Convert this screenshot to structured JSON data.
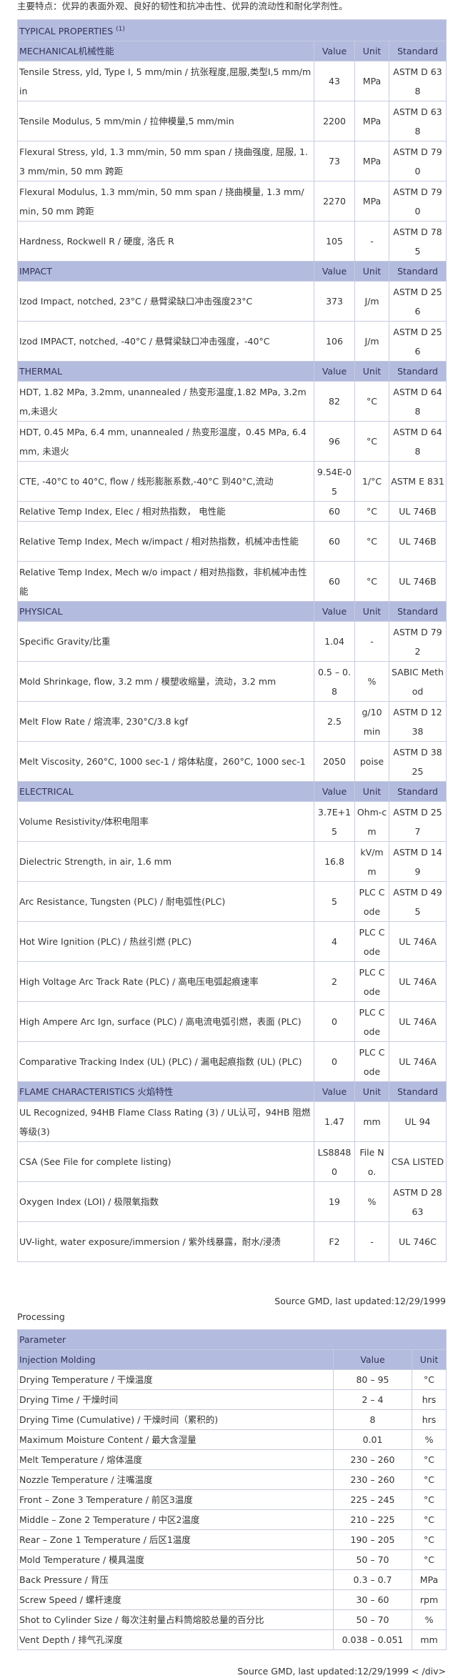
{
  "intro": "主要特点：优异的表面外观、良好的韧性和抗冲击性、优异的流动性和耐化学剂性。",
  "title": "TYPICAL PROPERTIES",
  "title_sup": "(1)",
  "headers": {
    "value": "Value",
    "unit": "Unit",
    "standard": "Standard"
  },
  "sections": [
    {
      "name": "MECHANICAL机械性能",
      "rows": [
        {
          "property": "Tensile Stress, yld, Type I, 5 mm/min / 抗张程度,屈服,类型I,5 mm/min",
          "value": "43",
          "unit": "MPa",
          "standard": "ASTM D 638"
        },
        {
          "property": "Tensile Modulus, 5 mm/min / 拉伸模量,5 mm/min",
          "value": "2200",
          "unit": "MPa",
          "standard": "ASTM D 638"
        },
        {
          "property": "Flexural Stress, yld, 1.3 mm/min, 50 mm span / 挠曲强度, 屈服, 1.3 mm/min, 50 mm 跨距",
          "value": "73",
          "unit": "MPa",
          "standard": "ASTM D 790"
        },
        {
          "property": "Flexural Modulus, 1.3 mm/min, 50 mm span / 挠曲模量, 1.3 mm/min, 50 mm 跨距",
          "value": "2270",
          "unit": "MPa",
          "standard": "ASTM D 790"
        },
        {
          "property": "Hardness, Rockwell R / 硬度, 洛氏 R",
          "value": "105",
          "unit": "-",
          "standard": "ASTM D 785"
        }
      ]
    },
    {
      "name": "IMPACT",
      "rows": [
        {
          "property": "Izod Impact, notched, 23°C / 悬臂梁缺口冲击强度23°C",
          "value": "373",
          "unit": "J/m",
          "standard": "ASTM D 256"
        },
        {
          "property": "Izod IMPACT, notched, -40°C / 悬臂梁缺口冲击强度，-40°C",
          "value": "106",
          "unit": "J/m",
          "standard": "ASTM D 256"
        }
      ]
    },
    {
      "name": "THERMAL",
      "rows": [
        {
          "property": "HDT, 1.82 MPa, 3.2mm, unannealed / 热变形温度,1.82 MPa, 3.2mm,未退火",
          "value": "82",
          "unit": "°C",
          "standard": "ASTM D 648"
        },
        {
          "property": "HDT, 0.45 MPa, 6.4 mm, unannealed / 热变形温度，0.45 MPa, 6.4 mm, 未退火",
          "value": "96",
          "unit": "°C",
          "standard": "ASTM D 648"
        },
        {
          "property": "CTE, -40°C to 40°C, flow / 线形膨胀系数,-40°C 到40°C,流动",
          "value": "9.54E-05",
          "unit": "1/°C",
          "standard": "ASTM E 831"
        },
        {
          "property": "Relative Temp Index, Elec / 相对热指数， 电性能",
          "value": "60",
          "unit": "°C",
          "standard": "UL 746B",
          "short": true
        },
        {
          "property": "Relative Temp Index, Mech w/impact / 相对热指数，机械冲击性能",
          "value": "60",
          "unit": "°C",
          "standard": "UL 746B"
        },
        {
          "property": "Relative Temp Index, Mech w/o impact / 相对热指数，非机械冲击性能",
          "value": "60",
          "unit": "°C",
          "standard": "UL 746B"
        }
      ]
    },
    {
      "name": "PHYSICAL",
      "rows": [
        {
          "property": "Specific Gravity/比重",
          "value": "1.04",
          "unit": "-",
          "standard": "ASTM D 792"
        },
        {
          "property": "Mold Shrinkage, flow, 3.2 mm / 模塑收缩量，流动，3.2 mm",
          "value": "0.5 – 0.8",
          "unit": "%",
          "standard": "SABIC Method"
        },
        {
          "property": "Melt Flow Rate / 熔流率, 230°C/3.8 kgf",
          "value": "2.5",
          "unit": "g/10 min",
          "standard": "ASTM D 1238"
        },
        {
          "property": "Melt Viscosity, 260°C, 1000 sec-1 / 熔体粘度，260°C, 1000 sec-1",
          "value": "2050",
          "unit": "poise",
          "standard": "ASTM D 3825"
        }
      ]
    },
    {
      "name": "ELECTRICAL",
      "rows": [
        {
          "property": "Volume Resistivity/体积电阻率",
          "value": "3.7E+15",
          "unit": "Ohm-cm",
          "standard": "ASTM D 257"
        },
        {
          "property": "Dielectric Strength, in air, 1.6 mm",
          "value": "16.8",
          "unit": "kV/mm",
          "standard": "ASTM D 149"
        },
        {
          "property": "Arc Resistance, Tungsten (PLC) / 耐电弧性(PLC)",
          "value": "5",
          "unit": "PLC Code",
          "standard": "ASTM D 495"
        },
        {
          "property": "Hot Wire Ignition (PLC) / 热丝引燃 (PLC)",
          "value": "4",
          "unit": "PLC Code",
          "standard": "UL 746A"
        },
        {
          "property": "High Voltage Arc Track Rate (PLC) / 高电压电弧起痕速率",
          "value": "2",
          "unit": "PLC Code",
          "standard": "UL 746A"
        },
        {
          "property": "High Ampere Arc Ign, surface (PLC) / 高电流电弧引燃，表面 (PLC)",
          "value": "0",
          "unit": "PLC Code",
          "standard": "UL 746A"
        },
        {
          "property": "Comparative Tracking Index (UL) (PLC) / 漏电起痕指数 (UL) (PLC)",
          "value": "0",
          "unit": "PLC Code",
          "standard": "UL 746A"
        }
      ]
    },
    {
      "name": "FLAME CHARACTERISTICS 火焰特性",
      "rows": [
        {
          "property": "UL Recognized, 94HB Flame Class Rating (3) / UL认可，94HB 阻燃等级(3)",
          "value": "1.47",
          "unit": "mm",
          "standard": "UL 94"
        },
        {
          "property": "CSA (See File for complete listing)",
          "value": "LS88480",
          "unit": "File No.",
          "standard": "CSA LISTED"
        },
        {
          "property": "Oxygen Index (LOI) / 极限氧指数",
          "value": "19",
          "unit": "%",
          "standard": "ASTM D 2863"
        },
        {
          "property": "UV-light, water exposure/immersion / 紫外线暴露，耐水/浸渍",
          "value": "F2",
          "unit": "-",
          "standard": "UL 746C"
        }
      ]
    }
  ],
  "source1": "Source GMD, last updated:12/29/1999",
  "processing": {
    "title": "Processing",
    "parameter": "Parameter",
    "section": "Injection Molding",
    "value": "Value",
    "unit": "Unit",
    "rows": [
      {
        "name": "Drying Temperature / 干燥温度",
        "value": "80 – 95",
        "unit": "°C"
      },
      {
        "name": "Drying Time / 干燥时间",
        "value": "2 – 4",
        "unit": "hrs"
      },
      {
        "name": "Drying Time (Cumulative) / 干燥时间（累积的)",
        "value": "8",
        "unit": "hrs"
      },
      {
        "name": "Maximum Moisture Content / 最大含湿量",
        "value": "0.01",
        "unit": "%"
      },
      {
        "name": "Melt Temperature / 熔体温度",
        "value": "230 – 260",
        "unit": "°C"
      },
      {
        "name": "Nozzle Temperature / 注嘴温度",
        "value": "230 – 260",
        "unit": "°C"
      },
      {
        "name": "Front – Zone 3 Temperature / 前区3温度",
        "value": "225 – 245",
        "unit": "°C"
      },
      {
        "name": "Middle – Zone 2 Temperature / 中区2温度",
        "value": "210 – 225",
        "unit": "°C"
      },
      {
        "name": "Rear – Zone 1 Temperature / 后区1温度",
        "value": "190 – 205",
        "unit": "°C"
      },
      {
        "name": "Mold Temperature / 模具温度",
        "value": "50 – 70",
        "unit": "°C"
      },
      {
        "name": "Back Pressure / 背压",
        "value": "0.3 – 0.7",
        "unit": "MPa"
      },
      {
        "name": "Screw Speed / 螺杆速度",
        "value": "30 – 60",
        "unit": "rpm"
      },
      {
        "name": "Shot to Cylinder Size / 每次注射量占料筒熔胶总量的百分比",
        "value": "50 – 70",
        "unit": "%"
      },
      {
        "name": "Vent Depth / 排气孔深度",
        "value": "0.038 – 0.051",
        "unit": "mm"
      }
    ]
  },
  "source2": "Source GMD, last updated:12/29/1999 < /div>"
}
